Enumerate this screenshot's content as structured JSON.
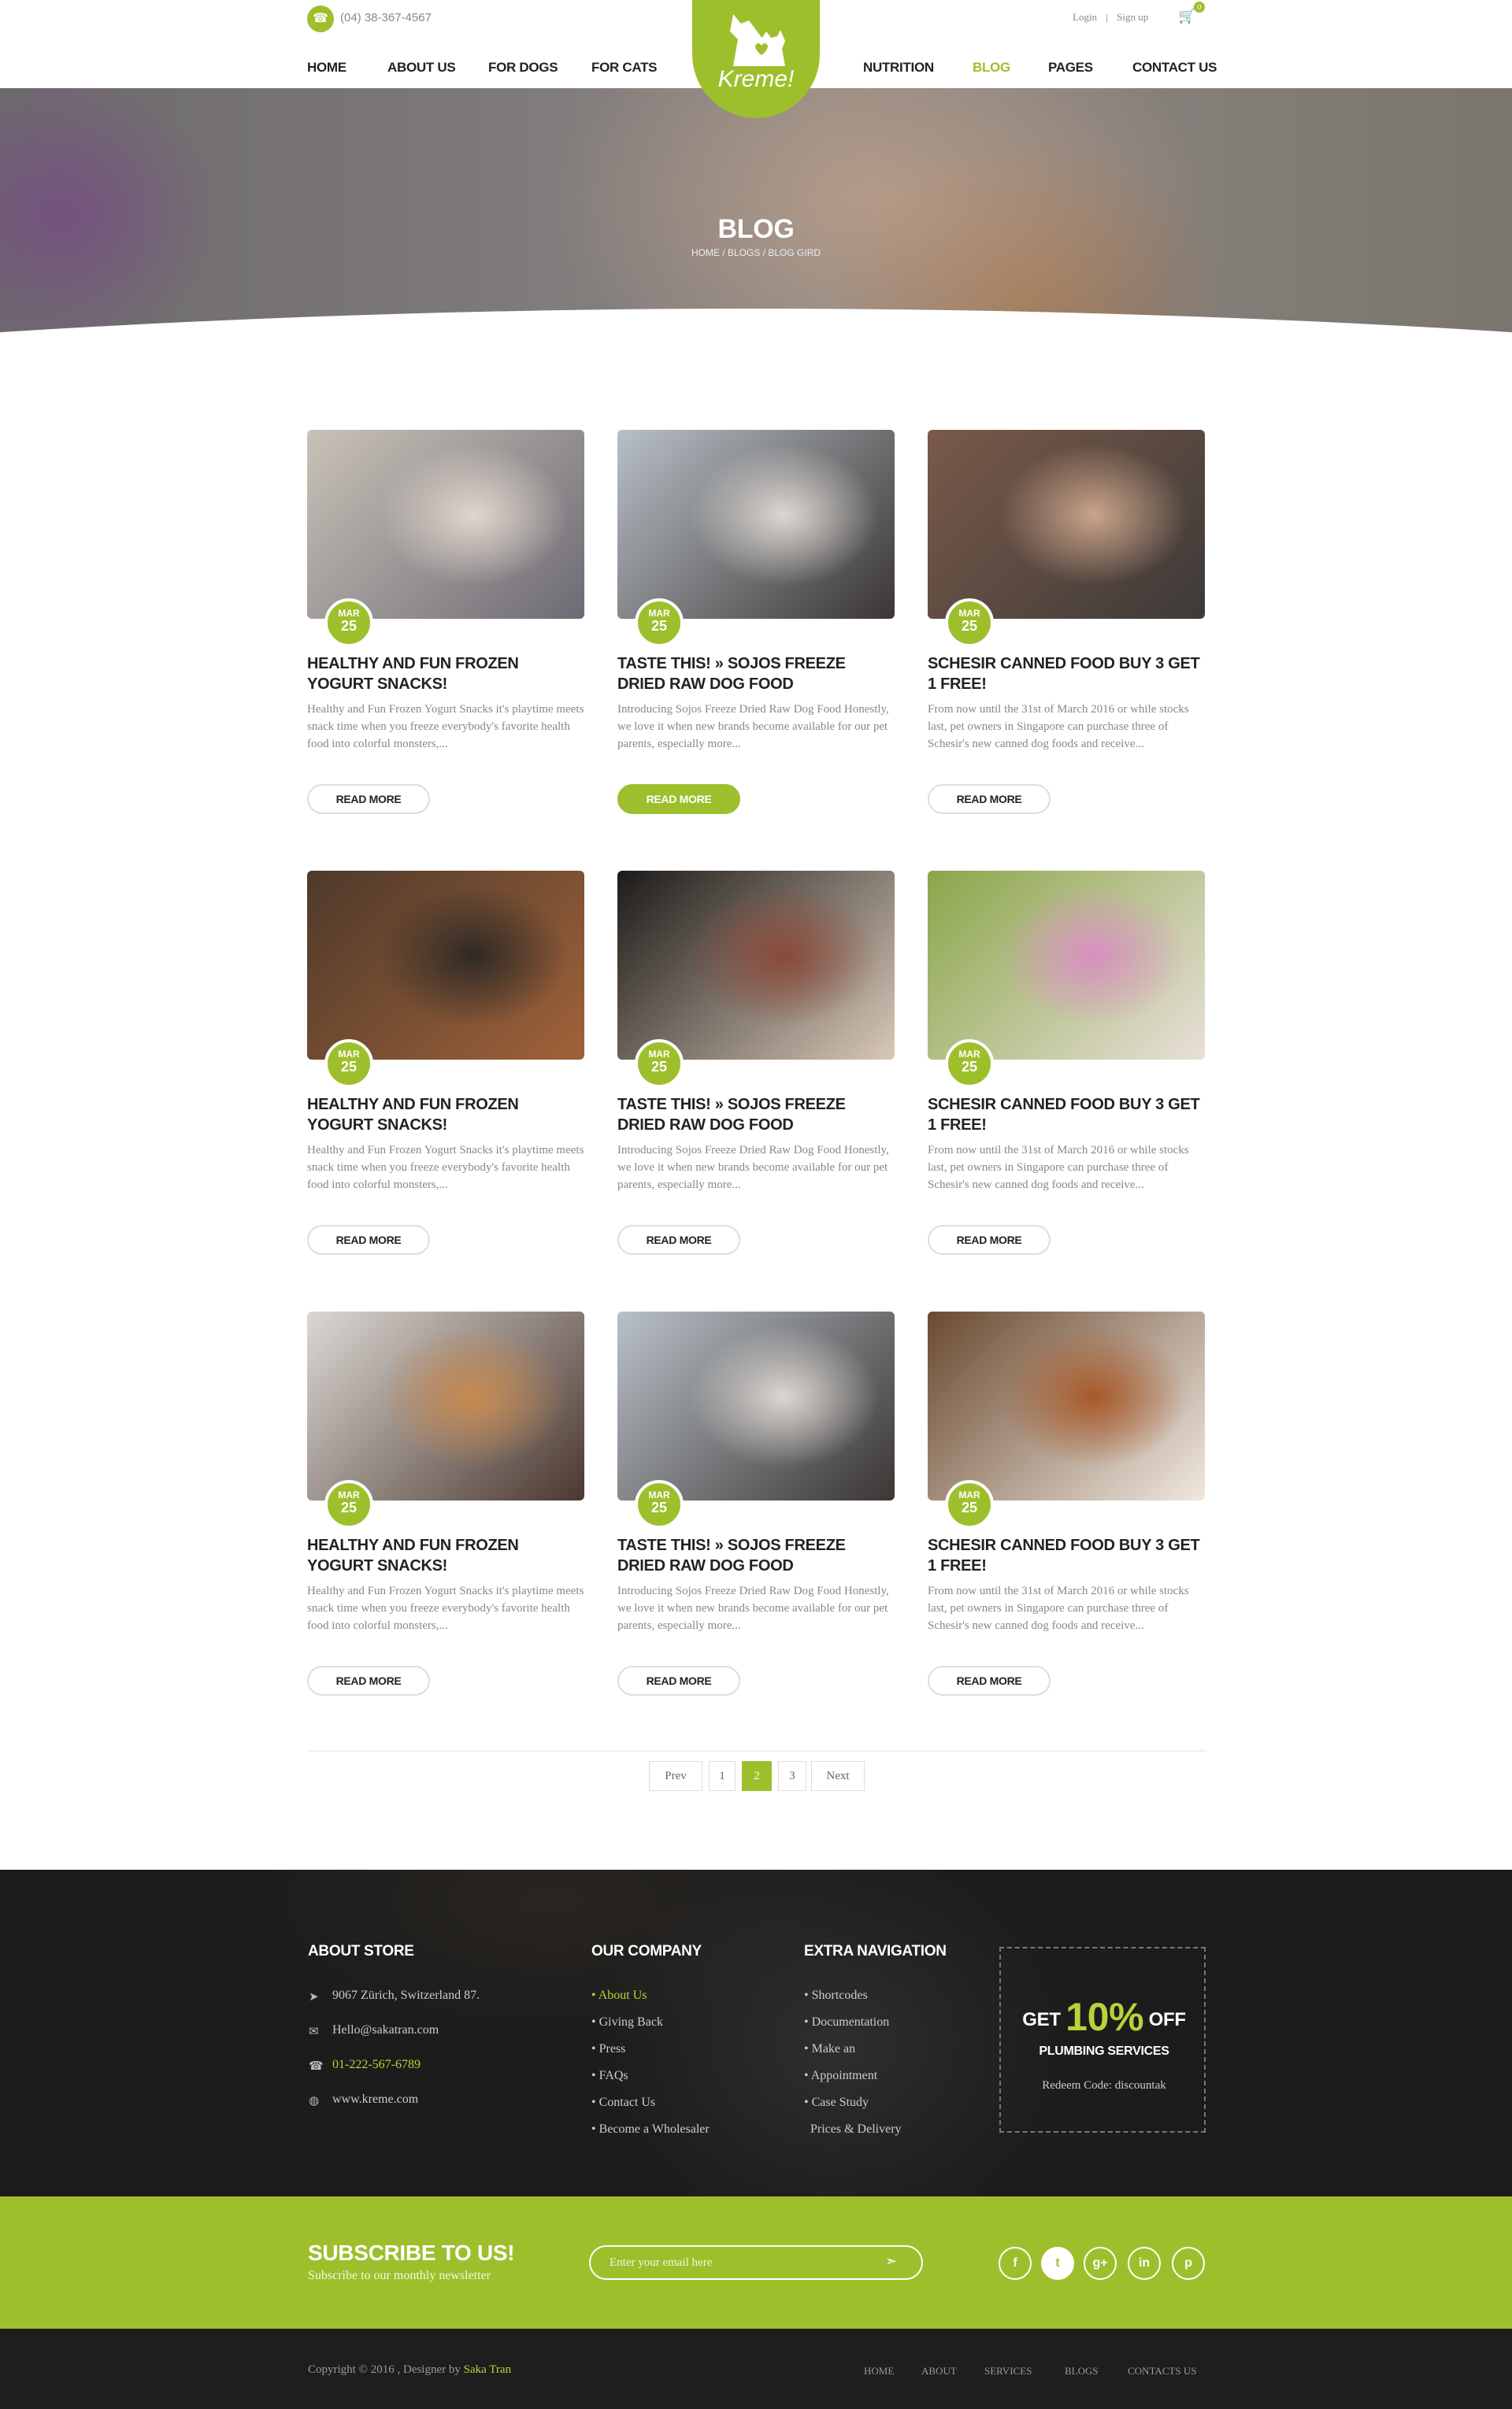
{
  "header": {
    "phone": "(04) 38-367-4567",
    "login": "Login",
    "signup": "Sign up",
    "cart_count": "0",
    "brand": "Kreme!",
    "nav": [
      "HOME",
      "ABOUT US",
      "FOR DOGS",
      "FOR CATS",
      "NUTRITION",
      "BLOG",
      "PAGES",
      "CONTACT US"
    ],
    "active_nav": "BLOG",
    "accent_color": "#9ebf2c"
  },
  "hero": {
    "title": "BLOG",
    "breadcrumb": [
      "HOME",
      "BLOGS",
      "BLOG GIRD"
    ]
  },
  "posts": [
    {
      "month": "MAR",
      "day": "25",
      "title": "HEALTHY AND FUN FROZEN YOGURT SNACKS!",
      "excerpt": "Healthy and Fun Frozen Yogurt Snacks it's playtime meets snack time when you freeze everybody's favorite health food into colorful monsters,...",
      "button": "READ MORE"
    },
    {
      "month": "MAR",
      "day": "25",
      "title": "TASTE THIS! » SOJOS FREEZE DRIED RAW DOG FOOD",
      "excerpt": "Introducing Sojos Freeze Dried Raw Dog Food Honestly, we love it when new brands become available for our pet parents, especially more...",
      "button": "READ MORE"
    },
    {
      "month": "MAR",
      "day": "25",
      "title": "SCHESIR CANNED FOOD BUY 3 GET 1 FREE!",
      "excerpt": "From now until the 31st of March 2016 or while stocks last, pet owners in Singapore can purchase three of Schesir's new canned dog foods and receive...",
      "button": "READ MORE"
    },
    {
      "month": "MAR",
      "day": "25",
      "title": "HEALTHY AND FUN FROZEN YOGURT SNACKS!",
      "excerpt": "Healthy and Fun Frozen Yogurt Snacks it's playtime meets snack time when you freeze everybody's favorite health food into colorful monsters,...",
      "button": "READ MORE"
    },
    {
      "month": "MAR",
      "day": "25",
      "title": "TASTE THIS! » SOJOS FREEZE DRIED RAW DOG FOOD",
      "excerpt": "Introducing Sojos Freeze Dried Raw Dog Food Honestly, we love it when new brands become available for our pet parents, especially more...",
      "button": "READ MORE"
    },
    {
      "month": "MAR",
      "day": "25",
      "title": "SCHESIR CANNED FOOD BUY 3 GET 1 FREE!",
      "excerpt": "From now until the 31st of March 2016 or while stocks last, pet owners in Singapore can purchase three of Schesir's new canned dog foods and receive...",
      "button": "READ MORE"
    },
    {
      "month": "MAR",
      "day": "25",
      "title": "HEALTHY AND FUN FROZEN YOGURT SNACKS!",
      "excerpt": "Healthy and Fun Frozen Yogurt Snacks it's playtime meets snack time when you freeze everybody's favorite health food into colorful monsters,...",
      "button": "READ MORE"
    },
    {
      "month": "MAR",
      "day": "25",
      "title": "TASTE THIS! » SOJOS FREEZE DRIED RAW DOG FOOD",
      "excerpt": "Introducing Sojos Freeze Dried Raw Dog Food Honestly, we love it when new brands become available for our pet parents, especially more...",
      "button": "READ MORE"
    },
    {
      "month": "MAR",
      "day": "25",
      "title": "SCHESIR CANNED FOOD BUY 3 GET 1 FREE!",
      "excerpt": "From now until the 31st of March 2016 or while stocks last, pet owners in Singapore can purchase three of Schesir's new canned dog foods and receive...",
      "button": "READ MORE"
    }
  ],
  "pagination": {
    "prev": "Prev",
    "pages": [
      "1",
      "2",
      "3"
    ],
    "current": "2",
    "next": "Next"
  },
  "footer": {
    "about_title": "ABOUT STORE",
    "address": "9067 Zürich, Switzerland 87.",
    "email": "Hello@sakatran.com",
    "phone": "01-222-567-6789",
    "website": "www.kreme.com",
    "company_title": "OUR COMPANY",
    "company_links": [
      "About Us",
      "Giving Back",
      "Press",
      "FAQs",
      "Contact Us",
      "Become a Wholesaler"
    ],
    "extra_title": "EXTRA NAVIGATION",
    "extra_links": [
      "Shortcodes",
      "Documentation",
      "Make an",
      "Appointment",
      "Case Study",
      "Prices & Delivery"
    ],
    "promo": {
      "get": "GET",
      "percent": "10%",
      "off": "OFF",
      "service": "PLUMBING SERVICES",
      "code": "Redeem Code: discountak"
    }
  },
  "subscribe": {
    "title": "SUBSCRIBE TO US!",
    "text": "Subscribe to our monthly newsletter",
    "placeholder": "Enter your email here",
    "social": [
      "f",
      "t",
      "g+",
      "in",
      "p"
    ]
  },
  "bottom": {
    "copyright_prefix": "Copyright © 2016 , Designer by",
    "designer": "Saka Tran",
    "links": [
      "HOME",
      "ABOUT",
      "SERVICES",
      "BLOGS",
      "CONTACTS US"
    ]
  }
}
